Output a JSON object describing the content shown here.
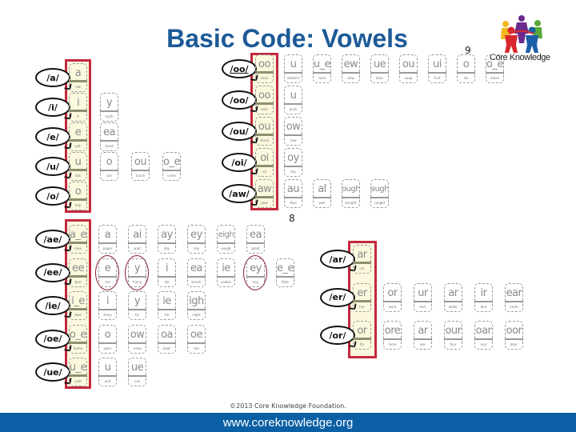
{
  "title": "Basic Code: Vowels",
  "page_numbers": {
    "top_panel": "9",
    "bottom_panel": "8"
  },
  "logo": {
    "text": "Core Knowledge",
    "icon": "people-circle-logo-icon"
  },
  "colors": {
    "title": "#1c5a97",
    "highlight_border": "#c4283e",
    "highlight_fill": "#fbf8de",
    "footer": "#0b5fa5",
    "circle_mark": "#8a2030"
  },
  "left_rows": [
    {
      "sound": "/a/",
      "cards": [
        {
          "g": "a",
          "w": "hat"
        }
      ]
    },
    {
      "sound": "/i/",
      "cards": [
        {
          "g": "i",
          "w": "it"
        },
        {
          "g": "y",
          "w": "myth"
        }
      ]
    },
    {
      "sound": "/e/",
      "cards": [
        {
          "g": "e",
          "w": "pet"
        },
        {
          "g": "ea",
          "w": "head"
        }
      ]
    },
    {
      "sound": "/u/",
      "cards": [
        {
          "g": "u",
          "w": "but"
        },
        {
          "g": "o",
          "w": "son"
        },
        {
          "g": "ou",
          "w": "touch"
        },
        {
          "g": "o_e",
          "w": "come"
        }
      ]
    },
    {
      "sound": "/o/",
      "cards": [
        {
          "g": "o",
          "w": "hop"
        }
      ]
    }
  ],
  "right_rows": [
    {
      "sound": "/oo/",
      "underline": true,
      "cards": [
        {
          "g": "oo",
          "w": "soon"
        },
        {
          "g": "u",
          "w": "student"
        },
        {
          "g": "u_e",
          "w": "tune"
        },
        {
          "g": "ew",
          "w": "new"
        },
        {
          "g": "ue",
          "w": "blue"
        },
        {
          "g": "ou",
          "w": "soup"
        },
        {
          "g": "ui",
          "w": "fruit"
        },
        {
          "g": "o",
          "w": "do"
        },
        {
          "g": "o_e",
          "w": "move"
        }
      ]
    },
    {
      "sound": "/oo/",
      "underline": false,
      "cards": [
        {
          "g": "oo",
          "w": "look"
        },
        {
          "g": "u",
          "w": "push"
        }
      ]
    },
    {
      "sound": "/ou/",
      "cards": [
        {
          "g": "ou",
          "w": "shout"
        },
        {
          "g": "ow",
          "w": "now"
        }
      ]
    },
    {
      "sound": "/oi/",
      "cards": [
        {
          "g": "oi",
          "w": "oil"
        },
        {
          "g": "oy",
          "w": "toy"
        }
      ]
    },
    {
      "sound": "/aw/",
      "cards": [
        {
          "g": "aw",
          "w": "paw"
        },
        {
          "g": "au",
          "w": "Paul"
        },
        {
          "g": "al",
          "w": "wall"
        },
        {
          "g": "ough",
          "w": "bought"
        },
        {
          "g": "augh",
          "w": "caught"
        }
      ]
    }
  ],
  "bottom_rows": [
    {
      "sound": "/ae/",
      "cards": [
        {
          "g": "a_e",
          "w": "cake"
        },
        {
          "g": "a",
          "w": "paper"
        },
        {
          "g": "ai",
          "w": "wait"
        },
        {
          "g": "ay",
          "w": "day"
        },
        {
          "g": "ey",
          "w": "hey"
        },
        {
          "g": "eigh",
          "w": "weigh"
        },
        {
          "g": "ea",
          "w": "great"
        }
      ]
    },
    {
      "sound": "/ee/",
      "cards": [
        {
          "g": "ee",
          "w": "bee"
        },
        {
          "g": "e",
          "w": "me",
          "circled": true
        },
        {
          "g": "y",
          "w": "funny",
          "circled": true
        },
        {
          "g": "i",
          "w": "ski"
        },
        {
          "g": "ea",
          "w": "beach"
        },
        {
          "g": "ie",
          "w": "cookie"
        },
        {
          "g": "ey",
          "w": "key",
          "circled": true
        },
        {
          "g": "e_e",
          "w": "Pete"
        }
      ]
    },
    {
      "sound": "/ie/",
      "cards": [
        {
          "g": "i_e",
          "w": "bike"
        },
        {
          "g": "i",
          "w": "shiny"
        },
        {
          "g": "y",
          "w": "try"
        },
        {
          "g": "ie",
          "w": "tie"
        },
        {
          "g": "igh",
          "w": "night"
        }
      ]
    },
    {
      "sound": "/oe/",
      "cards": [
        {
          "g": "o_e",
          "w": "home"
        },
        {
          "g": "o",
          "w": "open"
        },
        {
          "g": "ow",
          "w": "snow"
        },
        {
          "g": "oa",
          "w": "boat"
        },
        {
          "g": "oe",
          "w": "toe"
        }
      ]
    },
    {
      "sound": "/ue/",
      "cards": [
        {
          "g": "u_e",
          "w": "cute"
        },
        {
          "g": "u",
          "w": "unit"
        },
        {
          "g": "ue",
          "w": "cue"
        }
      ]
    }
  ],
  "r_rows": [
    {
      "sound": "/ar/",
      "cards": [
        {
          "g": "ar",
          "w": "car"
        }
      ]
    },
    {
      "sound": "/er/",
      "cards": [
        {
          "g": "er",
          "w": "her"
        },
        {
          "g": "or",
          "w": "work"
        },
        {
          "g": "ur",
          "w": "hurt"
        },
        {
          "g": "ar",
          "w": "dollar"
        },
        {
          "g": "ir",
          "w": "bird"
        },
        {
          "g": "ear",
          "w": "earth"
        }
      ]
    },
    {
      "sound": "/or/",
      "cards": [
        {
          "g": "or",
          "w": "for"
        },
        {
          "g": "ore",
          "w": "more"
        },
        {
          "g": "ar",
          "w": "war"
        },
        {
          "g": "our",
          "w": "four"
        },
        {
          "g": "oar",
          "w": "roar"
        },
        {
          "g": "oor",
          "w": "door"
        }
      ]
    }
  ],
  "copyright": "©2013 Core Knowledge Foundation.",
  "footer_url": "www.coreknowledge.org"
}
